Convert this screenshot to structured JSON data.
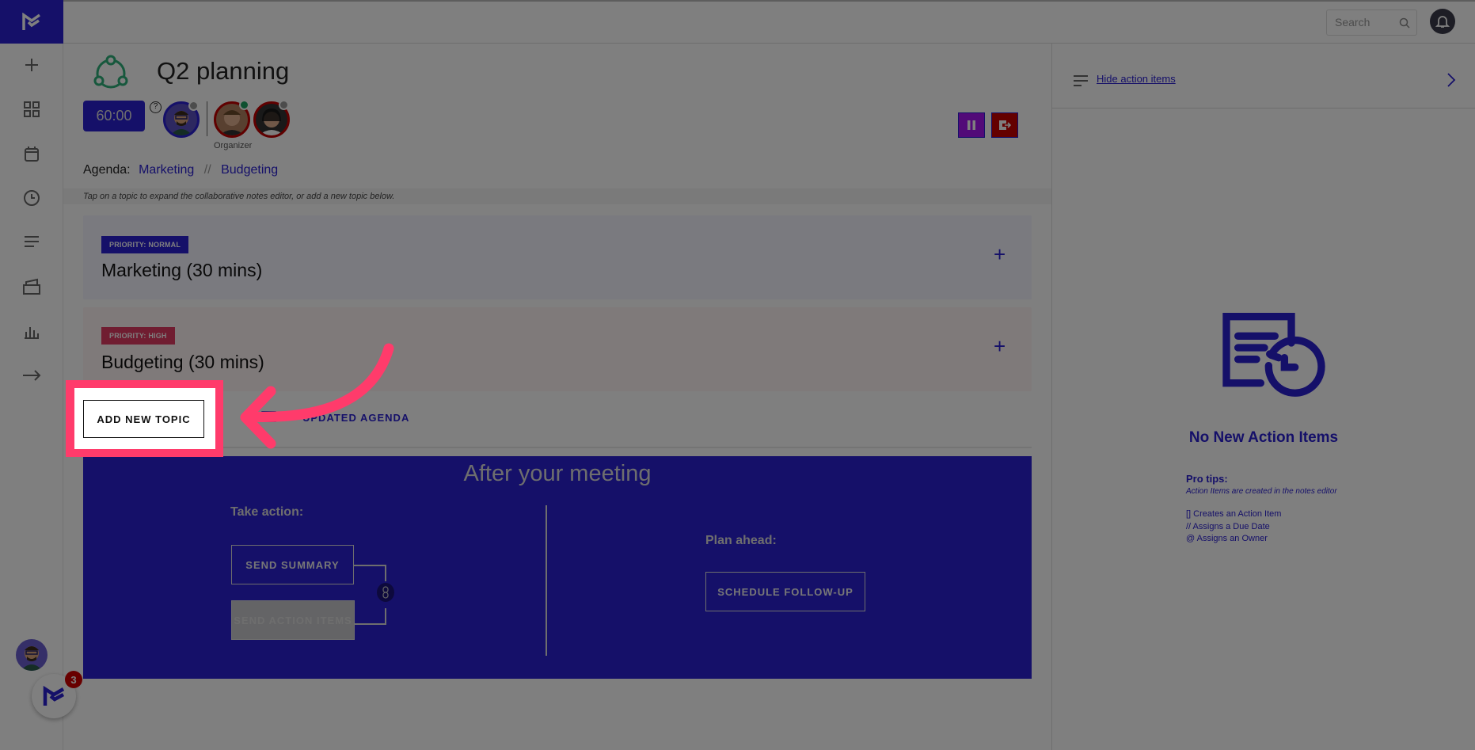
{
  "header": {
    "search_placeholder": "Search",
    "icons": [
      "search-icon",
      "bell-icon"
    ]
  },
  "sidebar": {
    "items": [
      "plus-icon",
      "dashboard-icon",
      "calendar-icon",
      "clock-icon",
      "list-icon",
      "inbox-icon",
      "chart-icon",
      "arrow-right-icon"
    ],
    "chat_badge": "3"
  },
  "meeting": {
    "title": "Q2 planning",
    "timer": "60:00",
    "organizer_label": "Organizer",
    "agenda_label": "Agenda:",
    "agenda_items": [
      "Marketing",
      "Budgeting"
    ],
    "agenda_separator": "//",
    "hint": "Tap on a topic to expand the collaborative notes editor, or add a new topic below."
  },
  "topics": [
    {
      "badge": "PRIORITY: NORMAL",
      "title": "Marketing (30 mins)",
      "badge_color": "#2b20d2"
    },
    {
      "badge": "PRIORITY: HIGH",
      "title": "Budgeting (30 mins)",
      "badge_color": "#e03a62"
    }
  ],
  "actions": {
    "add_topic": "ADD NEW TOPIC",
    "updated_agenda": "UPDATED AGENDA"
  },
  "after": {
    "title": "After your meeting",
    "take_action": "Take action:",
    "send_summary": "SEND SUMMARY",
    "send_action_items": "SEND ACTION ITEMS",
    "plan_ahead": "Plan ahead:",
    "schedule": "SCHEDULE FOLLOW-UP"
  },
  "right": {
    "hide_link": "Hide action items",
    "empty_title": "No New Action Items",
    "pro_tips": "Pro tips:",
    "tip_sub": "Action Items are created in the notes editor",
    "tips": [
      "[] Creates an Action Item",
      "// Assigns a Due Date",
      "@ Assigns an Owner"
    ]
  },
  "colors": {
    "primary": "#2b20d2",
    "highlight": "#ff3b6b"
  }
}
